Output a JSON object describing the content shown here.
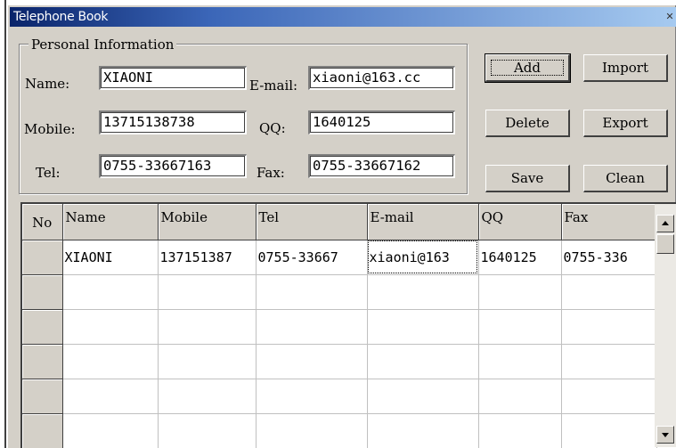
{
  "window": {
    "title": "Telephone Book"
  },
  "personal_info": {
    "group_label": "Personal Information",
    "name_label": "Name:",
    "name_value": "XIAONI",
    "email_label": "E-mail:",
    "email_value": "xiaoni@163.cc",
    "mobile_label": "Mobile:",
    "mobile_value": "13715138738",
    "qq_label": "QQ:",
    "qq_value": "1640125",
    "tel_label": "Tel:",
    "tel_value": "0755-33667163",
    "fax_label": "Fax:",
    "fax_value": "0755-33667162"
  },
  "buttons": {
    "add": "Add",
    "import": "Import",
    "delete": "Delete",
    "export": "Export",
    "save": "Save",
    "clean": "Clean"
  },
  "table": {
    "columns": [
      "No",
      "Name",
      "Mobile",
      "Tel",
      "E-mail",
      "QQ",
      "Fax"
    ],
    "rows": [
      [
        "",
        "XIAONI",
        "137151387",
        "0755-33667",
        "xiaoni@163",
        "1640125",
        "0755-336"
      ],
      [
        "",
        "",
        "",
        "",
        "",
        "",
        ""
      ],
      [
        "",
        "",
        "",
        "",
        "",
        "",
        ""
      ],
      [
        "",
        "",
        "",
        "",
        "",
        "",
        ""
      ],
      [
        "",
        "",
        "",
        "",
        "",
        "",
        ""
      ],
      [
        "",
        "",
        "",
        "",
        "",
        "",
        ""
      ]
    ]
  },
  "icons": {
    "close": "close-icon",
    "scroll_up": "scroll-up-arrow-icon",
    "scroll_down": "scroll-down-arrow-icon"
  },
  "colors": {
    "title_bar_start": "#0a246a",
    "title_bar_end": "#a6caf0",
    "face": "#d4d0c8"
  }
}
